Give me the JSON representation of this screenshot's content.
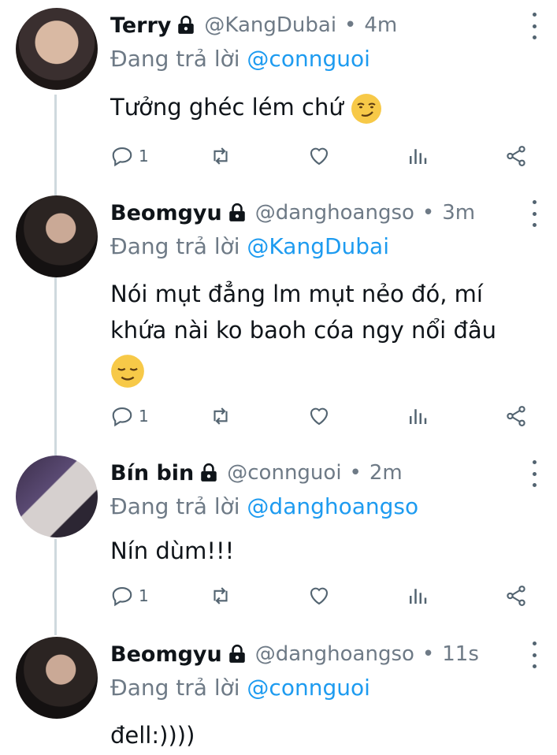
{
  "reply_prefix": "Đang trả lời",
  "tweets": [
    {
      "name": "Terry",
      "handle": "@KangDubai",
      "dot": "•",
      "time": "4m",
      "reply_to": "@connguoi",
      "text": "Tưởng ghéc lém chứ",
      "emoji": "smirking-face",
      "reply_count": "1"
    },
    {
      "name": "Beomgyu",
      "handle": "@danghoangso",
      "dot": "•",
      "time": "3m",
      "reply_to": "@KangDubai",
      "text_line1": "Nói mụt đẳng lm mụt nẻo đó, mí",
      "text_line2": "khứa nài ko baoh cóa ngy nổi đâu",
      "emoji": "relieved-face",
      "reply_count": "1"
    },
    {
      "name": "Bín bin",
      "handle": "@connguoi",
      "dot": "•",
      "time": "2m",
      "reply_to": "@danghoangso",
      "text": "Nín dùm!!!",
      "reply_count": "1"
    },
    {
      "name": "Beomgyu",
      "handle": "@danghoangso",
      "dot": "•",
      "time": "11s",
      "reply_to": "@connguoi",
      "text": "đell:))))"
    }
  ],
  "colors": {
    "muted": "#6e7a86",
    "mention": "#1d9bf0",
    "thread_line": "#cfd9de",
    "icon": "#536471"
  }
}
